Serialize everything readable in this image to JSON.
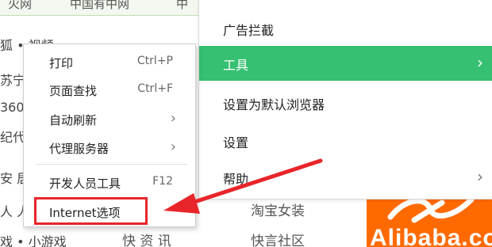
{
  "background": {
    "tabs": [
      "火网",
      "中国有中网",
      "中"
    ],
    "lines": [
      "狐 • 视频",
      "苏宁",
      "360",
      "纪代",
      "安 居",
      "人 人",
      "戏 • 小游戏"
    ],
    "links": [
      "淘宝女装",
      "快 资 讯",
      "快言社区"
    ],
    "ad": {
      "text": "Alibaba.co",
      "color": "#ff6a00"
    }
  },
  "main_menu": {
    "items": [
      {
        "label": "广告拦截",
        "has_submenu": false,
        "active": false
      },
      {
        "label": "工具",
        "has_submenu": true,
        "active": true
      },
      {
        "label": "设置为默认浏览器",
        "has_submenu": false,
        "active": false
      },
      {
        "label": "设置",
        "has_submenu": false,
        "active": false
      },
      {
        "label": "帮助",
        "has_submenu": true,
        "active": false
      }
    ],
    "active_color": "#35c072"
  },
  "tools_submenu": {
    "items": [
      {
        "label": "打印",
        "shortcut": "Ctrl+P"
      },
      {
        "label": "页面查找",
        "shortcut": "Ctrl+F"
      },
      {
        "label": "自动刷新",
        "shortcut": ""
      },
      {
        "label": "代理服务器",
        "shortcut": ""
      },
      {
        "label": "开发人员工具",
        "shortcut": "F12"
      },
      {
        "label": "Internet选项",
        "shortcut": ""
      }
    ]
  },
  "annotation": {
    "color": "#e8252a"
  }
}
